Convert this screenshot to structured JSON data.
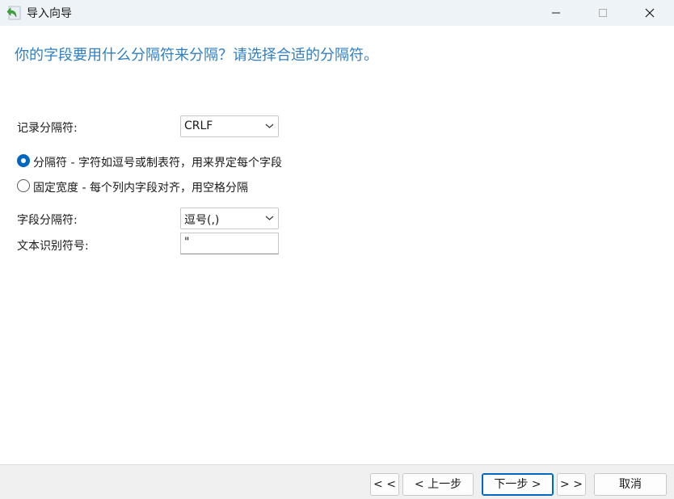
{
  "window": {
    "title": "导入向导",
    "icon": "back-arrow-icon"
  },
  "heading": "你的字段要用什么分隔符来分隔？请选择合适的分隔符。",
  "record_delimiter": {
    "label": "记录分隔符:",
    "value": "CRLF"
  },
  "format_options": [
    {
      "label": "分隔符 - 字符如逗号或制表符，用来界定每个字段",
      "checked": true
    },
    {
      "label": "固定宽度 - 每个列内字段对齐，用空格分隔",
      "checked": false
    }
  ],
  "field_delimiter": {
    "label": "字段分隔符:",
    "value": "逗号(,)"
  },
  "text_qualifier": {
    "label": "文本识别符号:",
    "value": "\""
  },
  "footer": {
    "first_label": "< <",
    "back_label": "< 上一步",
    "next_label": "下一步 >",
    "last_label": "> >",
    "cancel_label": "取消"
  },
  "colors": {
    "heading": "#2e7fc2",
    "accent": "#0067c0",
    "titlebar": "#eef3f8",
    "footer": "#f0f0f0"
  }
}
